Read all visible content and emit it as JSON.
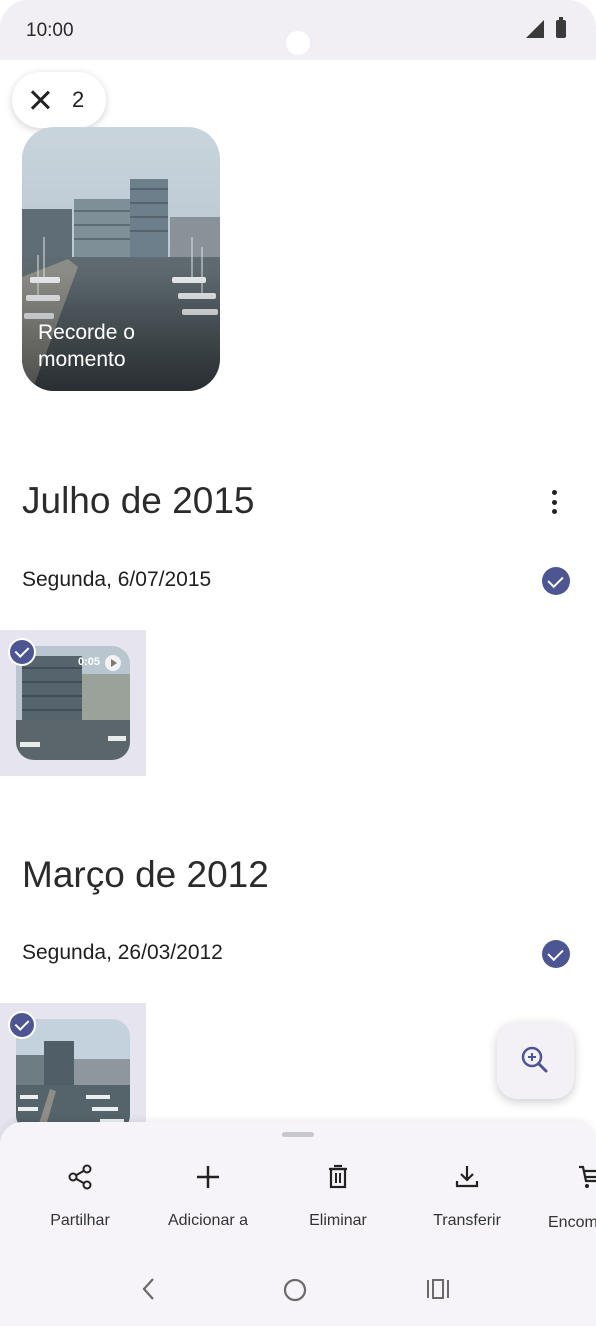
{
  "status_bar": {
    "time": "10:00"
  },
  "selection": {
    "count": "2"
  },
  "memory": {
    "label": "Recorde o momento"
  },
  "sections": [
    {
      "month": "Julho de 2015",
      "day": "Segunda, 6/07/2015",
      "video_duration": "0:05"
    },
    {
      "month": "Março de 2012",
      "day": "Segunda, 26/03/2012"
    }
  ],
  "actions": [
    {
      "label": "Partilhar",
      "icon": "share-icon"
    },
    {
      "label": "Adicionar a",
      "icon": "add-icon"
    },
    {
      "label": "Eliminar",
      "icon": "delete-icon"
    },
    {
      "label": "Transferir",
      "icon": "download-icon"
    },
    {
      "label": "Encom fot",
      "icon": "cart-icon"
    }
  ],
  "colors": {
    "accent": "#4d5692",
    "tile_bg": "#e6e4ee",
    "sheet_bg": "#f6f4f9"
  }
}
